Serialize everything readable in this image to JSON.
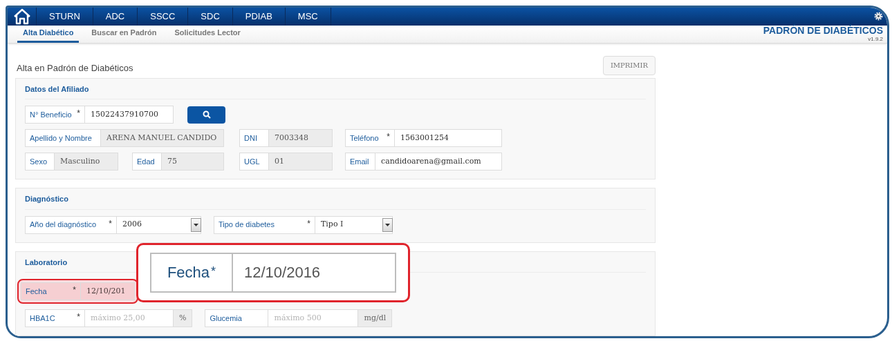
{
  "nav": [
    {
      "label": "STURN"
    },
    {
      "label": "ADC"
    },
    {
      "label": "SSCC"
    },
    {
      "label": "SDC"
    },
    {
      "label": "PDIAB"
    },
    {
      "label": "MSC"
    }
  ],
  "subtabs": [
    {
      "label": "Alta Diabético",
      "selected": true
    },
    {
      "label": "Buscar en Padrón",
      "selected": false
    },
    {
      "label": "Solicitudes Lector",
      "selected": false
    }
  ],
  "app_title": "PADRÓN DE DIABÉTICOS",
  "version": "v1.9.2",
  "page_title": "Alta en Padrón de Diabéticos",
  "print_button": "IMPRIMIR",
  "sections": [
    {
      "title": "Datos del Afiliado",
      "rows": [
        {
          "fields": [
            {
              "kind": "text",
              "label": "N° Beneficio",
              "marker": "*",
              "value": "15022437910700",
              "readonly": false,
              "highlighted": false
            },
            {
              "kind": "search"
            }
          ]
        },
        {
          "fields": [
            {
              "kind": "text",
              "label": "Apellido y Nombre",
              "value": "ARENA MANUEL CANDIDO",
              "readonly": true,
              "highlighted": false
            },
            {
              "kind": "text",
              "label": "DNI",
              "value": "7003348",
              "readonly": true,
              "highlighted": false
            },
            {
              "kind": "text",
              "label": "Teléfono",
              "marker": "*",
              "value": "1563001254",
              "readonly": false,
              "highlighted": false
            }
          ]
        },
        {
          "fields": [
            {
              "kind": "text",
              "label": "Sexo",
              "value": "Masculino",
              "readonly": true,
              "highlighted": false
            },
            {
              "kind": "text",
              "label": "Edad",
              "value": "75",
              "readonly": true,
              "highlighted": false
            },
            {
              "kind": "text",
              "label": "UGL",
              "value": "01",
              "readonly": true,
              "highlighted": false
            },
            {
              "kind": "text",
              "label": "Email",
              "value": "candidoarena@gmail.com",
              "readonly": false,
              "highlighted": false
            }
          ]
        }
      ]
    },
    {
      "title": "Diagnóstico",
      "rows": [
        {
          "fields": [
            {
              "kind": "select",
              "label": "Año del diagnóstico",
              "marker": "*",
              "value": "2006",
              "readonly": false,
              "highlighted": false
            },
            {
              "kind": "select",
              "label": "Tipo de diabetes",
              "marker": "*",
              "value": "Tipo I",
              "readonly": false,
              "highlighted": false
            }
          ]
        }
      ]
    },
    {
      "title": "Laboratorio",
      "rows": [
        {
          "fields": [
            {
              "kind": "text",
              "label": "Fecha",
              "marker": "*",
              "value": "12/10/201",
              "readonly": false,
              "highlighted": true
            }
          ]
        },
        {
          "fields": [
            {
              "kind": "text",
              "label": "HBA1C",
              "marker": "*",
              "placeholder": "máximo 25,00",
              "unit": "%",
              "readonly": false,
              "highlighted": false
            },
            {
              "kind": "text",
              "label": "Glucemia",
              "placeholder": "máximo 500",
              "unit": "mg/dl",
              "readonly": false,
              "highlighted": false
            }
          ]
        }
      ]
    }
  ],
  "callout": {
    "label": "Fecha",
    "marker": "*",
    "value": "12/10/2016"
  }
}
